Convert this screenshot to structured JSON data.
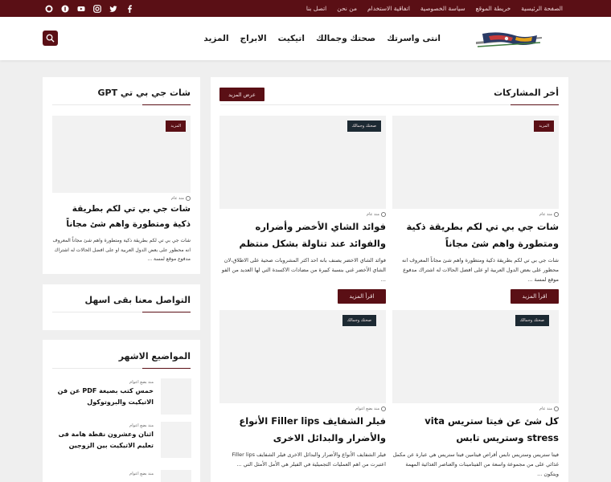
{
  "topbar": {
    "links": [
      "الصفحة الرئيسية",
      "خريطة الموقع",
      "سياسة الخصوصية",
      "اتفاقية الاستخدام",
      "من نحن",
      "اتصل بنا"
    ],
    "socials": [
      "facebook-icon",
      "twitter-icon",
      "instagram-icon",
      "youtube-icon",
      "pinterest-icon",
      "whatsapp-icon"
    ]
  },
  "header": {
    "nav": [
      "انتى واسرتك",
      "صحتك وجمالك",
      "اتيكيت",
      "الابراج",
      "المزيد"
    ]
  },
  "main": {
    "title": "أخر المشاركات",
    "more_button": "عرض المزيد",
    "posts": [
      {
        "tag": "المزيد",
        "meta": "منذ عام",
        "title": "شات جي بي تي لكم بطريقة ذكية ومتطورة واهم شئ مجاناً",
        "excerpt": "شات جي بي تي لكم بطريقة ذكية ومتطورة واهم شئ مجاناً المعروف انه محظور على بعض الدول العربية او على افضل الحالات له اشتراك مدفوع موقع لمسة ...",
        "read_more": "اقرأ المزيد"
      },
      {
        "tag": "صحتك وجمالك",
        "meta": "منذ عام",
        "title": "فوائد الشاي الأخضر وأضراره والفوائد عند تناولة بشكل منتظم",
        "excerpt": "فوائد الشاي الاخضر يصنف بانه احد اكثر المشروبات صحية على الاطلاق،لان الشاي الأخضر غني بنسبة كبيرة من مضادات الاكسدة التي لها العديد من الفو ...",
        "read_more": "اقرأ المزيد"
      },
      {
        "tag": "صحتك وجمالك",
        "meta": "منذ عام",
        "title": "كل شئ عن فيتا ستريس vita stress وستريس تابس",
        "excerpt": "فيتا ستريس وستريس تابس أقراص فيتامين فيتا ستريس هي عبارة عن مكمل غذائي على من مجموعة واسعة من الفيتامينات والعناصر الغذائية المهمة ويتكون ..."
      },
      {
        "tag": "صحتك وجمالك",
        "meta": "منذ بضع اعوام",
        "title": "فيلر الشفايف Filler lips الأنواع والأضرار والبدائل الاخرى",
        "excerpt": "فيلر الشفايف الأنواع والأضرار والبدائل الاخرى فيلر الشفايف Filler lips اعتبرت من اهم العمليات التجميلية في الفيلر هي الأمل الأمثل التي ..."
      }
    ]
  },
  "side_chat": {
    "title": "شات جي بي تي GPT",
    "tag": "المزيد",
    "meta": "منذ عام",
    "post_title": "شات جي بي تي لكم بطريقة ذكية ومتطورة واهم شئ مجاناً",
    "excerpt": "شات جي بي تي لكم بطريقة ذكية ومتطورة واهم شئ مجاناً المعروف انه محظور على بعض الدول العربية او على افضل الحالات له اشتراك مدفوع موقع لمسة ..."
  },
  "side_contact": {
    "title": "التواصل معنا بقى اسهل"
  },
  "side_popular": {
    "title": "المواضيع الاشهر",
    "items": [
      {
        "meta": "منذ بضع اعوام",
        "title": "خمس كتب بصيغة PDF عن فن الاتيكيت والبروتوكول"
      },
      {
        "meta": "منذ بضع اعوام",
        "title": "اثنان وعشرون نقطة هامة فى تعليم الاتيكيت بين الزوجين"
      },
      {
        "meta": "منذ بضع اعوام",
        "title": ""
      }
    ]
  }
}
